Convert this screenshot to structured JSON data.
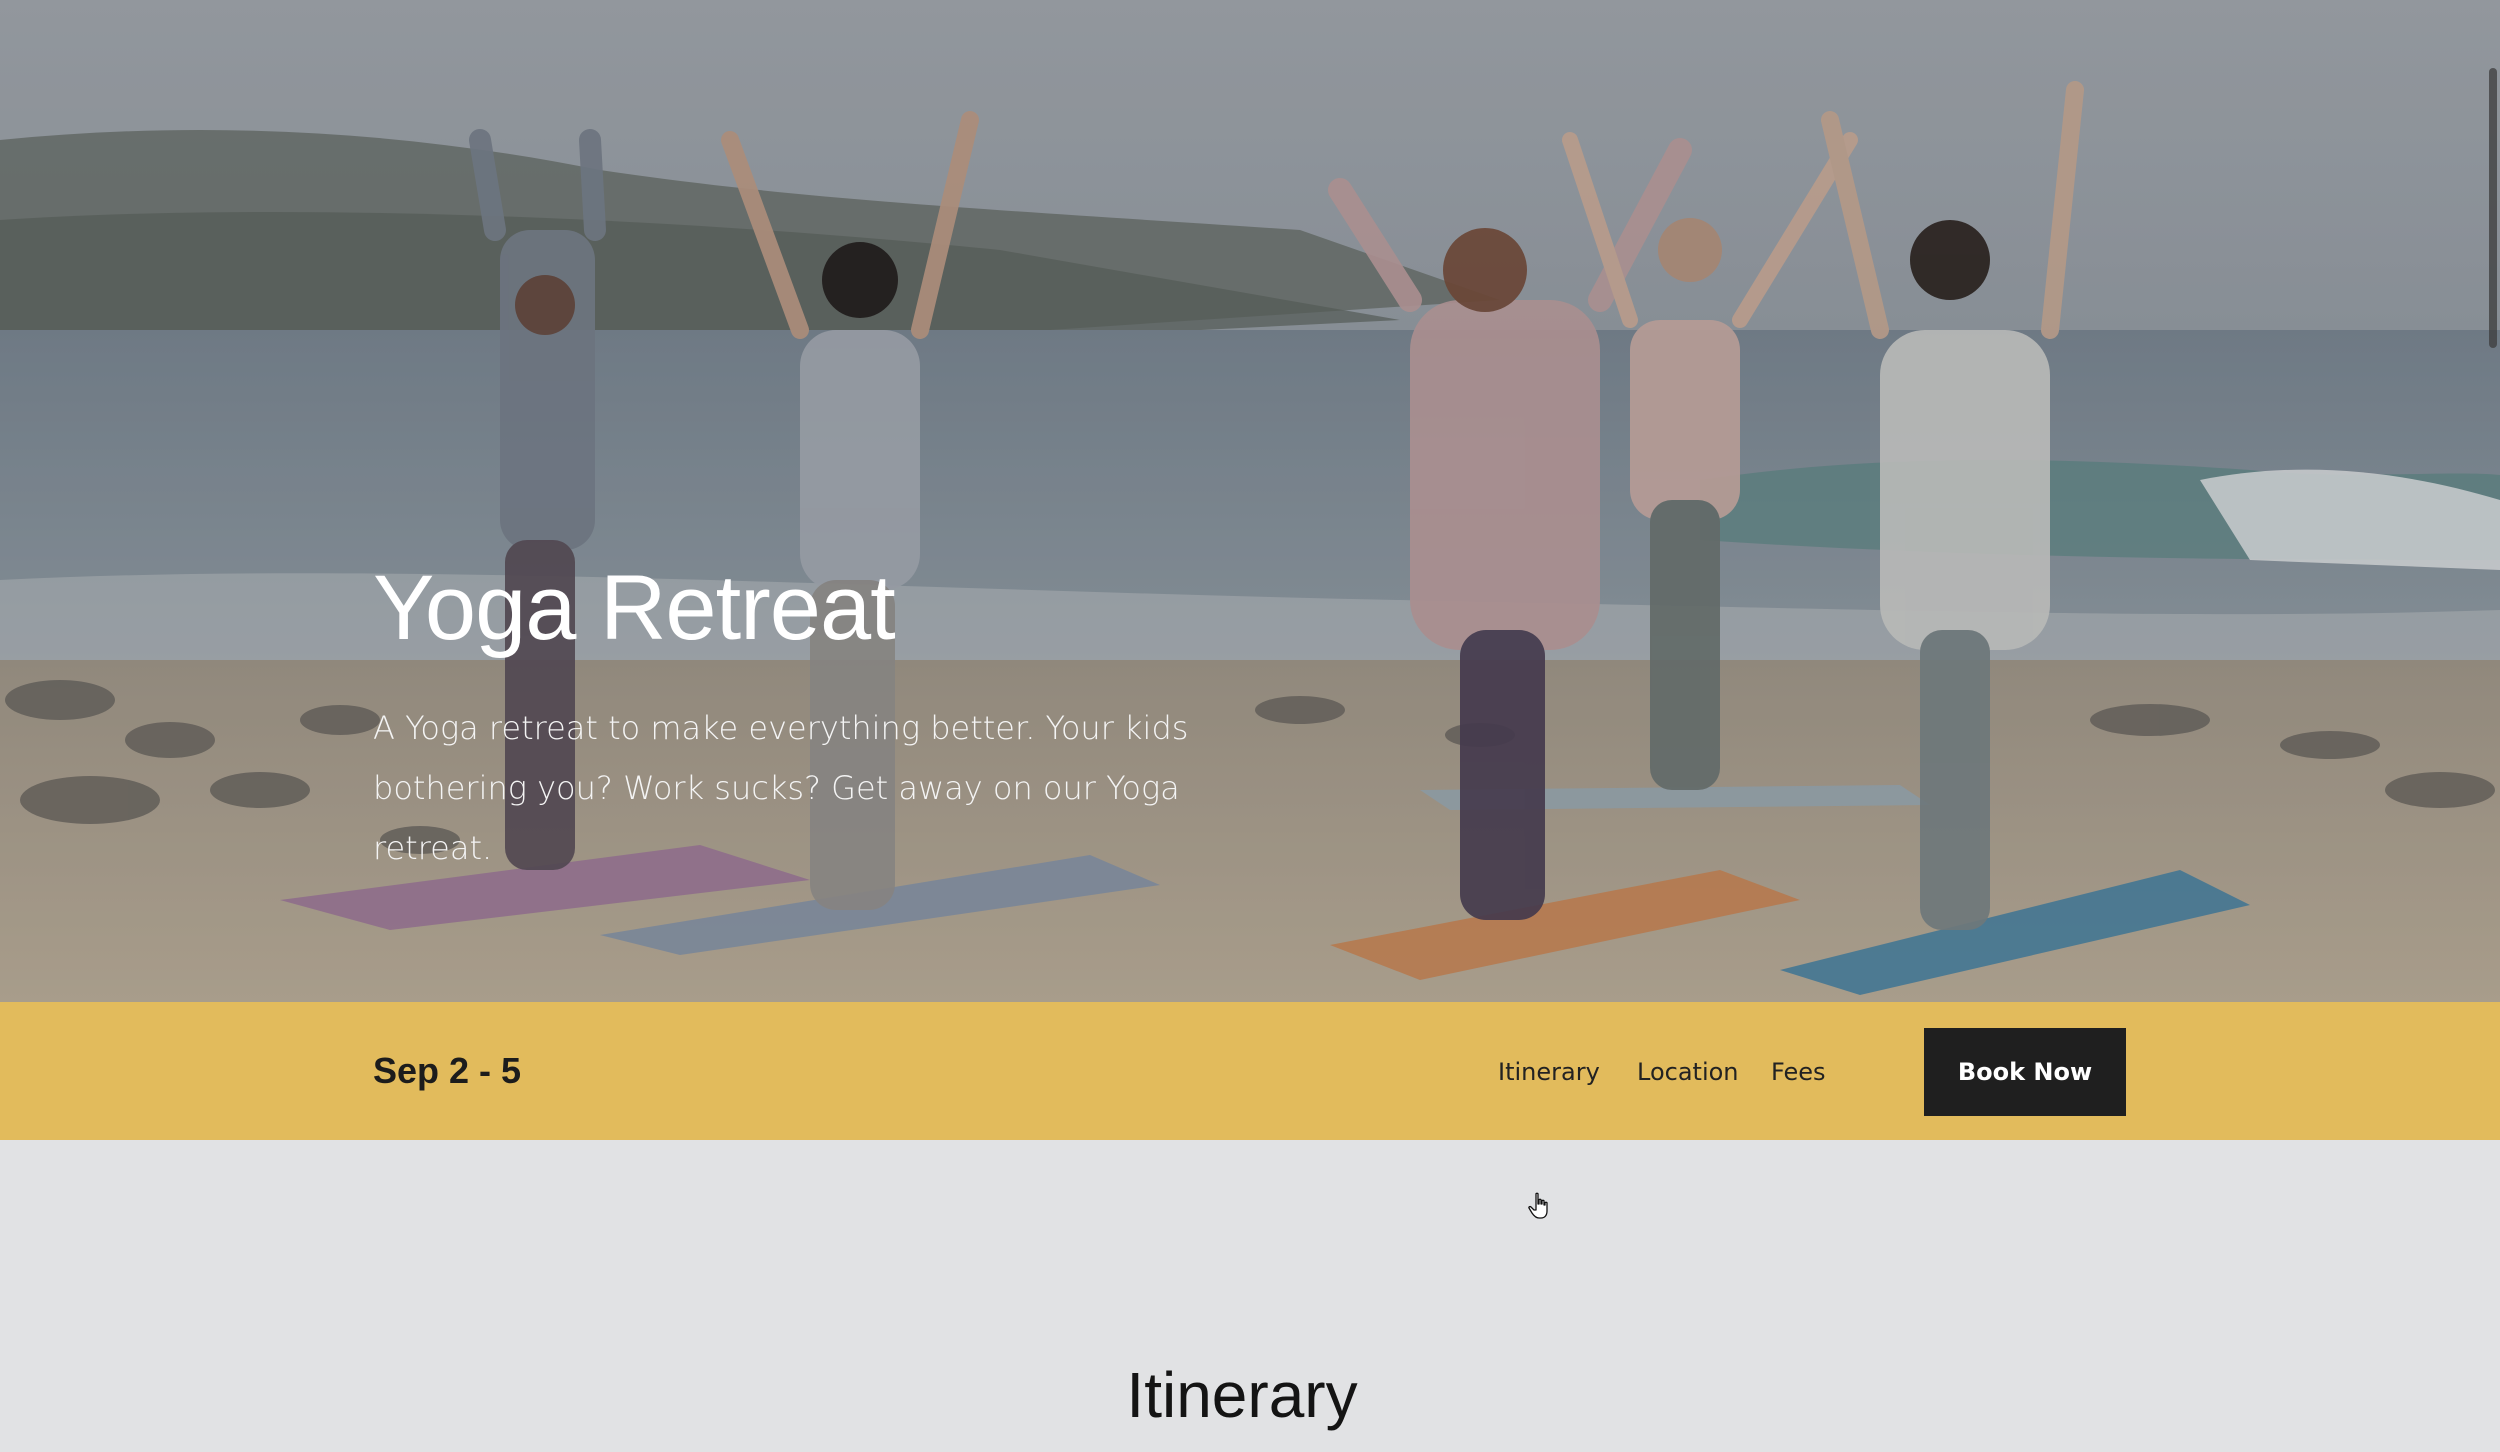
{
  "hero": {
    "title": "Yoga Retreat",
    "description": "A Yoga retreat to make everything better. Your kids bothering you? Work sucks? Get away on our Yoga retreat."
  },
  "band": {
    "date": "Sep 2 - 5",
    "nav": {
      "itinerary": "Itinerary",
      "location": "Location",
      "fees": "Fees"
    },
    "book_label": "Book Now",
    "background_color": "#e2bb5c"
  },
  "section": {
    "title": "Itinerary"
  },
  "colors": {
    "page_background": "#e1e2e4",
    "button_background": "#1f1f1f",
    "hero_text": "#ffffff"
  }
}
